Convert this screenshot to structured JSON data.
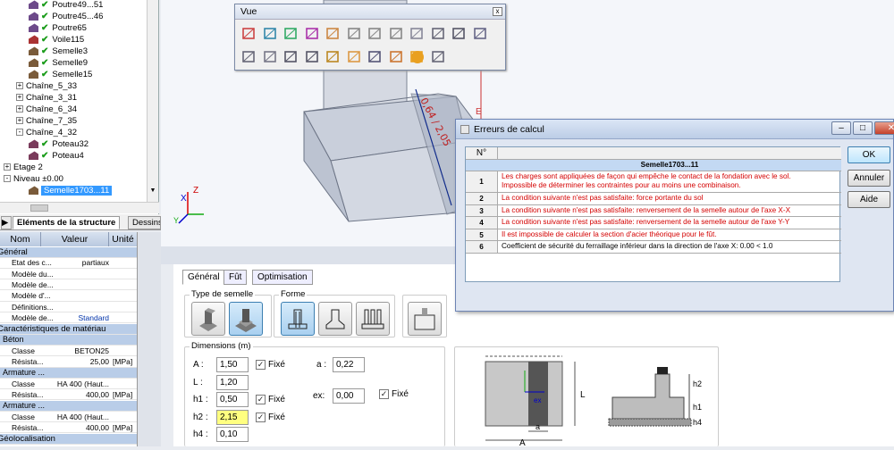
{
  "tree": {
    "items": [
      {
        "indent": 2,
        "label": "Poutre49...51",
        "icon": "beam-icon",
        "checked": true
      },
      {
        "indent": 2,
        "label": "Poutre45...46",
        "icon": "beam-icon",
        "checked": true
      },
      {
        "indent": 2,
        "label": "Poutre65",
        "icon": "beam-icon",
        "checked": true
      },
      {
        "indent": 2,
        "label": "Voile115",
        "icon": "wall-icon",
        "checked": true
      },
      {
        "indent": 2,
        "label": "Semelle3",
        "icon": "footing-icon",
        "checked": true
      },
      {
        "indent": 2,
        "label": "Semelle9",
        "icon": "footing-icon",
        "checked": true
      },
      {
        "indent": 2,
        "label": "Semelle15",
        "icon": "footing-icon",
        "checked": true
      },
      {
        "indent": 1,
        "label": "Chaîne_5_33",
        "expander": "+"
      },
      {
        "indent": 1,
        "label": "Chaîne_3_31",
        "expander": "+"
      },
      {
        "indent": 1,
        "label": "Chaîne_6_34",
        "expander": "+"
      },
      {
        "indent": 1,
        "label": "Chaîne_7_35",
        "expander": "+"
      },
      {
        "indent": 1,
        "label": "Chaîne_4_32",
        "expander": "-"
      },
      {
        "indent": 2,
        "label": "Poteau32",
        "icon": "column-icon",
        "checked": true
      },
      {
        "indent": 2,
        "label": "Poteau4",
        "icon": "column-icon",
        "checked": true
      },
      {
        "indent": 0,
        "label": "Etage 2",
        "expander": "+"
      },
      {
        "indent": 0,
        "label": "Niveau ±0.00",
        "expander": "-"
      },
      {
        "indent": 2,
        "label": "Semelle1703...11",
        "icon": "footing-icon",
        "selected": true
      }
    ]
  },
  "side_tabs": {
    "structure": "Eléments de la structure",
    "drawings": "Dessins"
  },
  "props": {
    "headers": {
      "name": "Nom",
      "value": "Valeur",
      "unit": "Unité"
    },
    "rows": [
      {
        "type": "sec",
        "name": "Général"
      },
      {
        "name": "Etat des c...",
        "value": "partiaux"
      },
      {
        "name": "Modèle du..."
      },
      {
        "name": "Modèle de..."
      },
      {
        "name": "Modèle d'..."
      },
      {
        "name": "Définitions..."
      },
      {
        "name": "Modèle de...",
        "value": "Standard",
        "blue": true
      },
      {
        "type": "sec",
        "name": "Caractéristiques de matériau"
      },
      {
        "type": "sub",
        "name": "Béton"
      },
      {
        "name": "Classe",
        "value": "BETON25"
      },
      {
        "name": "Résista...",
        "value": "25,00",
        "unit": "[MPa]"
      },
      {
        "type": "sub",
        "name": "Armature ..."
      },
      {
        "name": "Classe",
        "value": "HA 400 (Haut..."
      },
      {
        "name": "Résista...",
        "value": "400,00",
        "unit": "[MPa]"
      },
      {
        "type": "sub",
        "name": "Armature ..."
      },
      {
        "name": "Classe",
        "value": "HA 400 (Haut..."
      },
      {
        "name": "Résista...",
        "value": "400,00",
        "unit": "[MPa]"
      },
      {
        "type": "sec",
        "name": "Géolocalisation"
      }
    ]
  },
  "vue_toolbar": {
    "title": "Vue",
    "close_symbol": "x"
  },
  "viewport": {
    "dimension_text": "0,64 / 2,05",
    "axis_x": "X",
    "axis_z": "Z",
    "axis_y": "Y",
    "marker": "E"
  },
  "editor": {
    "tabs": [
      "Général",
      "Fût",
      "Optimisation"
    ],
    "type_label": "Type de semelle",
    "forme_label": "Forme",
    "dims_label": "Dimensions (m)",
    "fields": [
      {
        "label": "A :",
        "value": "1,50",
        "fixe": true
      },
      {
        "label": "L :",
        "value": "1,20",
        "fixe": false
      },
      {
        "label": "h1 :",
        "value": "0,50",
        "fixe": true
      },
      {
        "label": "h2 :",
        "value": "2,15",
        "fixe": true,
        "highlight": true
      },
      {
        "label": "h4 :",
        "value": "0,10",
        "fixe": false
      }
    ],
    "a_label": "a :",
    "a_value": "0,22",
    "ex_label": "ex:",
    "ex_value": "0,00",
    "fixe_label": "Fixé",
    "ex_fixe": true,
    "sketch": {
      "A": "A",
      "L": "L",
      "a": "a",
      "h1": "h1",
      "h2": "h2",
      "h4": "h4",
      "ex": "ex"
    }
  },
  "errors_dialog": {
    "title": "Erreurs de calcul",
    "col_num": "N°",
    "group": "Semelle1703...11",
    "rows": [
      {
        "n": "1",
        "text": "Les charges sont appliquées de façon qui empêche le contact de la fondation avec le sol.",
        "text2": "Impossible de déterminer les contraintes pour au moins une combinaison.",
        "red": true
      },
      {
        "n": "2",
        "text": "La condition suivante n'est pas satisfaite: force portante du sol",
        "red": true
      },
      {
        "n": "3",
        "text": "La condition suivante n'est pas satisfaite: renversement de la semelle autour de l'axe X-X",
        "red": true
      },
      {
        "n": "4",
        "text": "La condition suivante n'est pas satisfaite: renversement de la semelle autour de l'axe Y-Y",
        "red": true
      },
      {
        "n": "5",
        "text": "Il est impossible de calculer la section d'acier théorique pour le fût.",
        "red": true
      },
      {
        "n": "6",
        "text": "Coefficient de sécurité du ferraillage inférieur dans la direction de l'axe X: 0.00 < 1.0",
        "red": false
      }
    ],
    "buttons": {
      "ok": "OK",
      "cancel": "Annuler",
      "help": "Aide"
    }
  },
  "colors": {
    "accent": "#3399ff",
    "error": "#d40000",
    "ok_check": "#1a9c1a",
    "highlight": "#ffff80"
  }
}
